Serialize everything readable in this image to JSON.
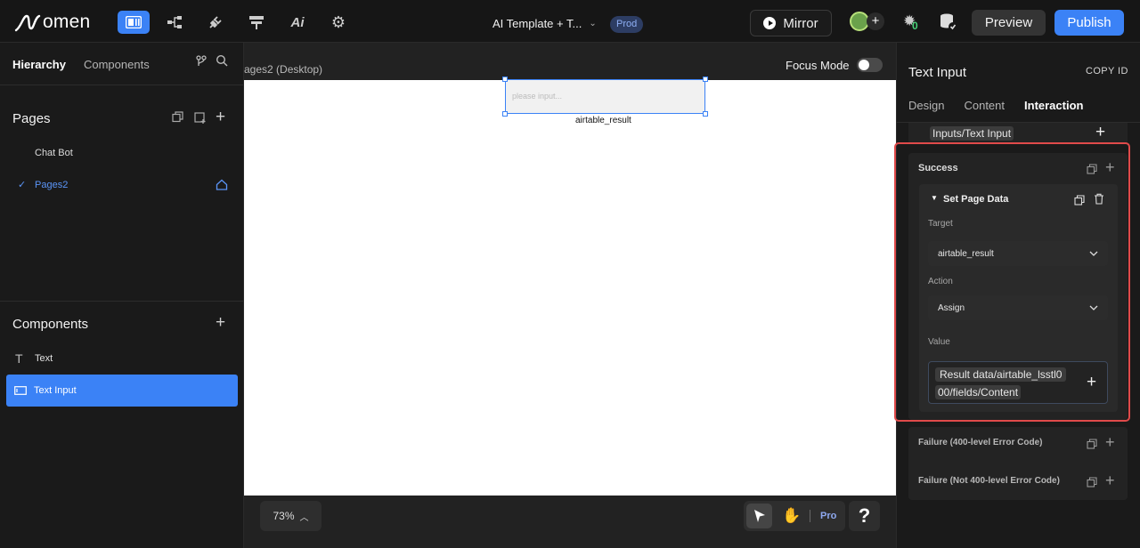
{
  "app": {
    "logo_text": "omen",
    "doc_title": "AI Template + T...",
    "env_badge": "Prod",
    "mirror_label": "Mirror",
    "collab_count": "0",
    "preview_label": "Preview",
    "publish_label": "Publish"
  },
  "left_panel": {
    "tabs": [
      "Hierarchy",
      "Components"
    ],
    "pages_title": "Pages",
    "pages": [
      {
        "label": "Chat Bot",
        "selected": false
      },
      {
        "label": "Pages2",
        "selected": true
      }
    ],
    "components_title": "Components",
    "components": [
      {
        "label": "Text",
        "icon": "text-icon",
        "selected": false
      },
      {
        "label": "Text Input",
        "icon": "text-input-icon",
        "selected": true
      }
    ]
  },
  "canvas": {
    "page_label": "ages2 (Desktop)",
    "focus_mode_label": "Focus Mode",
    "input_placeholder": "please input...",
    "result_label": "airtable_result",
    "zoom_label": "73%",
    "pro_label": "Pro",
    "help_label": "?"
  },
  "right_panel": {
    "title": "Text Input",
    "copy_id_label": "COPY ID",
    "tabs": [
      "Design",
      "Content",
      "Interaction"
    ],
    "active_tab": "Interaction",
    "source_chip": "Inputs/Text Input",
    "success_label": "Success",
    "action_title": "Set Page Data",
    "target_label": "Target",
    "target_value": "airtable_result",
    "action_label": "Action",
    "action_value": "Assign",
    "value_label": "Value",
    "value_line1": "Result data/airtable_lsstl0",
    "value_line2": "00/fields/Content",
    "failure_400": "Failure (400-level Error Code)",
    "failure_not400": "Failure (Not 400-level Error Code)"
  },
  "colors": {
    "accent": "#3b82f6",
    "highlight": "#e04a4a"
  }
}
